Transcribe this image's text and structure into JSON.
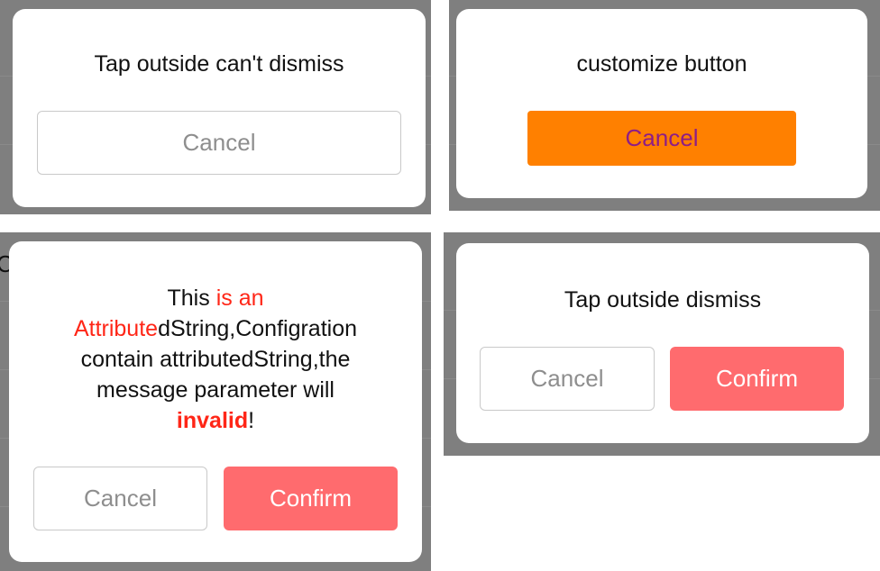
{
  "dialog_top_left": {
    "message": "Tap outside can't dismiss",
    "cancel_label": "Cancel"
  },
  "dialog_top_right": {
    "message": "customize button",
    "cancel_label": "Cancel",
    "button_bg_color": "#ff8000",
    "button_text_color": "#8e1d86"
  },
  "dialog_bottom_left": {
    "message_parts": {
      "p1": "This ",
      "p2": "is an",
      "p3": "Attribute",
      "p4": "dString,Configration",
      "p5": "contain attributedString,the",
      "p6": "message parameter will",
      "p7": "invalid",
      "p8": "!"
    },
    "highlight_color": "#ff2617",
    "cancel_label": "Cancel",
    "confirm_label": "Confirm"
  },
  "dialog_bottom_right": {
    "message": "Tap outside dismiss",
    "cancel_label": "Cancel",
    "confirm_label": "Confirm"
  },
  "background_peek_text": "C",
  "colors": {
    "overlay": "#7f7f7f",
    "confirm": "#ff6b6e",
    "outline_text": "#8e8e8e"
  }
}
